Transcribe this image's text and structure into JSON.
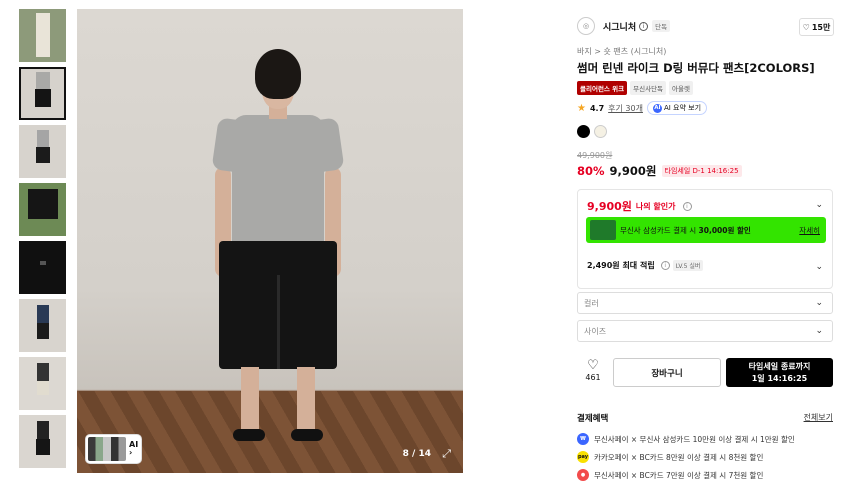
{
  "gallery": {
    "counter": "8 / 14",
    "ai_label": "AI",
    "thumbnail_count": 8
  },
  "product": {
    "brand": "시그니처",
    "brand_tag": "단독",
    "likes": "15만",
    "breadcrumb": "바지 > 숏 팬츠 (시그니처)",
    "title": "썸머 린넨 라이크 D링 버뮤다 팬츠[2COLORS]",
    "badges": [
      "클리어런스 위크",
      "무신사단독",
      "아울렛"
    ],
    "rating": "4.7",
    "reviews": "후기 30개",
    "ai_summary": "AI 요약 보기",
    "colors": [
      "#000000",
      "#f5f1e4"
    ],
    "original_price": "49,900원",
    "discount": "80%",
    "price": "9,900원",
    "timesale": "타임세일 D-1 14:16:25"
  },
  "benefit": {
    "my_price": "9,900원",
    "my_price_label": "나의 할인가",
    "promo_text_pre": "무신사 삼성카드 결제 시 ",
    "promo_text_bold": "30,000원 할인",
    "promo_more": "자세히",
    "points": "2,490원 최대 적립",
    "level": "LV.5 실버"
  },
  "options": {
    "color_placeholder": "컬러",
    "size_placeholder": "사이즈"
  },
  "actions": {
    "wish_count": "461",
    "cart": "장바구니",
    "buy_line1": "타임세일 종료까지",
    "buy_line2": "1일 14:16:25"
  },
  "payment": {
    "title": "결제혜택",
    "view_all": "전체보기",
    "rows": [
      {
        "text": "무신사페이 × 무신사 삼성카드 10만원 이상 결제 시 1만원 할인",
        "color": "#3b66ff"
      },
      {
        "text": "카카오페이 × BC카드 8만원 이상 결제 시 8천원 할인",
        "color": "#f9e000"
      },
      {
        "text": "무신사페이 × BC카드 7만원 이상 결제 시 7천원 할인",
        "color": "#f24b4b"
      }
    ]
  }
}
